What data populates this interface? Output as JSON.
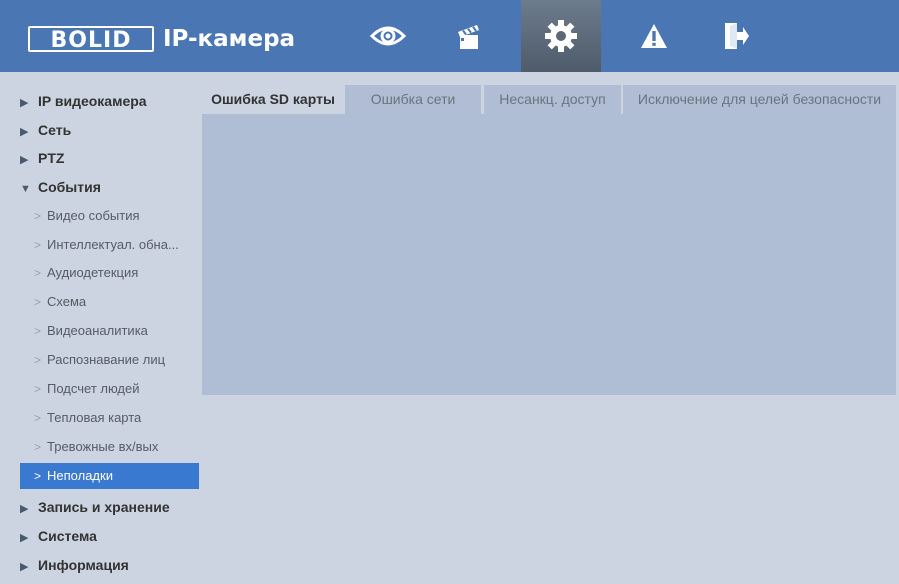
{
  "header": {
    "logo_box_text": "BOLID",
    "logo_text": "IP-камера",
    "nav_icons": [
      "eye-icon",
      "clapperboard-icon",
      "gear-icon",
      "warning-icon",
      "logout-icon"
    ],
    "active_nav": "gear-icon"
  },
  "sidebar": {
    "sections": [
      {
        "label": "IP видеокамера"
      },
      {
        "label": "Сеть"
      },
      {
        "label": "PTZ"
      },
      {
        "label": "События"
      },
      {
        "label": "Запись и хранение"
      },
      {
        "label": "Система"
      },
      {
        "label": "Информация"
      }
    ],
    "subitems": [
      {
        "label": "Видео события"
      },
      {
        "label": "Интеллектуал. обна..."
      },
      {
        "label": "Аудиодетекция"
      },
      {
        "label": "Схема"
      },
      {
        "label": "Видеоаналитика"
      },
      {
        "label": "Распознавание лиц"
      },
      {
        "label": "Подсчет людей"
      },
      {
        "label": "Тепловая карта"
      },
      {
        "label": "Тревожные вх/вых"
      },
      {
        "label": "Неполадки"
      }
    ],
    "active_item": "Неполадки"
  },
  "tabs": [
    {
      "label": "Ошибка SD карты"
    },
    {
      "label": "Ошибка сети"
    },
    {
      "label": "Несанкц. доступ"
    },
    {
      "label": "Исключение для целей безопасности"
    }
  ],
  "active_tab": "Ошибка SD карты",
  "colors": {
    "header": "#4a77b4",
    "active_sidebar": "#3979cf",
    "background": "#cbd4e0",
    "panel": "#afbdd5"
  }
}
